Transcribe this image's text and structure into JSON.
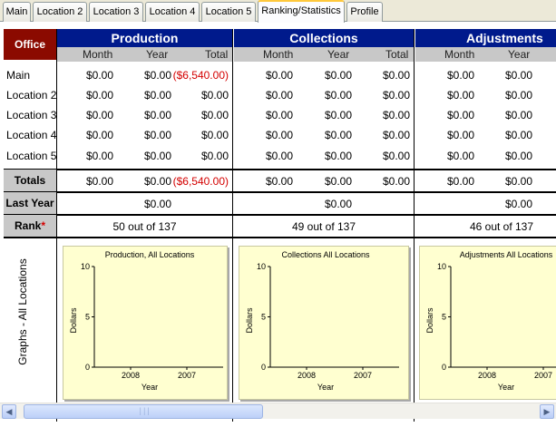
{
  "tabs": [
    "Main",
    "Location 2",
    "Location 3",
    "Location 4",
    "Location 5",
    "Ranking/Statistics",
    "Profile"
  ],
  "active_tab": "Ranking/Statistics",
  "office_header": "Office",
  "sections": [
    {
      "title": "Production",
      "cols": [
        "Month",
        "Year",
        "Total"
      ]
    },
    {
      "title": "Collections",
      "cols": [
        "Month",
        "Year",
        "Total"
      ]
    },
    {
      "title": "Adjustments",
      "cols": [
        "Month",
        "Year"
      ]
    }
  ],
  "rows": [
    {
      "label": "Main",
      "prod": [
        "$0.00",
        "$0.00",
        "($6,540.00)"
      ],
      "coll": [
        "$0.00",
        "$0.00",
        "$0.00"
      ],
      "adj": [
        "$0.00",
        "$0.00"
      ]
    },
    {
      "label": "Location 2",
      "prod": [
        "$0.00",
        "$0.00",
        "$0.00"
      ],
      "coll": [
        "$0.00",
        "$0.00",
        "$0.00"
      ],
      "adj": [
        "$0.00",
        "$0.00"
      ]
    },
    {
      "label": "Location 3",
      "prod": [
        "$0.00",
        "$0.00",
        "$0.00"
      ],
      "coll": [
        "$0.00",
        "$0.00",
        "$0.00"
      ],
      "adj": [
        "$0.00",
        "$0.00"
      ]
    },
    {
      "label": "Location 4",
      "prod": [
        "$0.00",
        "$0.00",
        "$0.00"
      ],
      "coll": [
        "$0.00",
        "$0.00",
        "$0.00"
      ],
      "adj": [
        "$0.00",
        "$0.00"
      ]
    },
    {
      "label": "Location 5",
      "prod": [
        "$0.00",
        "$0.00",
        "$0.00"
      ],
      "coll": [
        "$0.00",
        "$0.00",
        "$0.00"
      ],
      "adj": [
        "$0.00",
        "$0.00"
      ]
    }
  ],
  "totals": {
    "label": "Totals",
    "prod": [
      "$0.00",
      "$0.00",
      "($6,540.00)"
    ],
    "coll": [
      "$0.00",
      "$0.00",
      "$0.00"
    ],
    "adj": [
      "$0.00",
      "$0.00"
    ]
  },
  "last_year": {
    "label": "Last Year",
    "prod": "$0.00",
    "coll": "$0.00",
    "adj": "$0.00"
  },
  "rank": {
    "label": "Rank",
    "star": "*",
    "prod": "50 out of 137",
    "coll": "49 out of 137",
    "adj": "46 out of 137"
  },
  "graphs_label": "Graphs - All Locations",
  "colors": {
    "negative": "#d40000",
    "section_header": "#001a8c",
    "office_header": "#8b0a00",
    "graph_bg": "#ffffd0"
  },
  "chart_data": [
    {
      "type": "bar",
      "title": "Production, All Locations",
      "xlabel": "Year",
      "ylabel": "Dollars",
      "categories": [
        "2008",
        "2007"
      ],
      "values": [
        0,
        0
      ],
      "ylim": [
        0,
        10
      ],
      "yticks": [
        "10",
        "5",
        "0"
      ]
    },
    {
      "type": "bar",
      "title": "Collections All Locations",
      "xlabel": "Year",
      "ylabel": "Dollars",
      "categories": [
        "2008",
        "2007"
      ],
      "values": [
        0,
        0
      ],
      "ylim": [
        0,
        10
      ],
      "yticks": [
        "10",
        "5",
        "0"
      ]
    },
    {
      "type": "bar",
      "title": "Adjustments All Locations",
      "xlabel": "Year",
      "ylabel": "Dollars",
      "categories": [
        "2008",
        "2007"
      ],
      "values": [
        0,
        0
      ],
      "ylim": [
        0,
        10
      ],
      "yticks": [
        "10",
        "5",
        "0"
      ]
    }
  ]
}
